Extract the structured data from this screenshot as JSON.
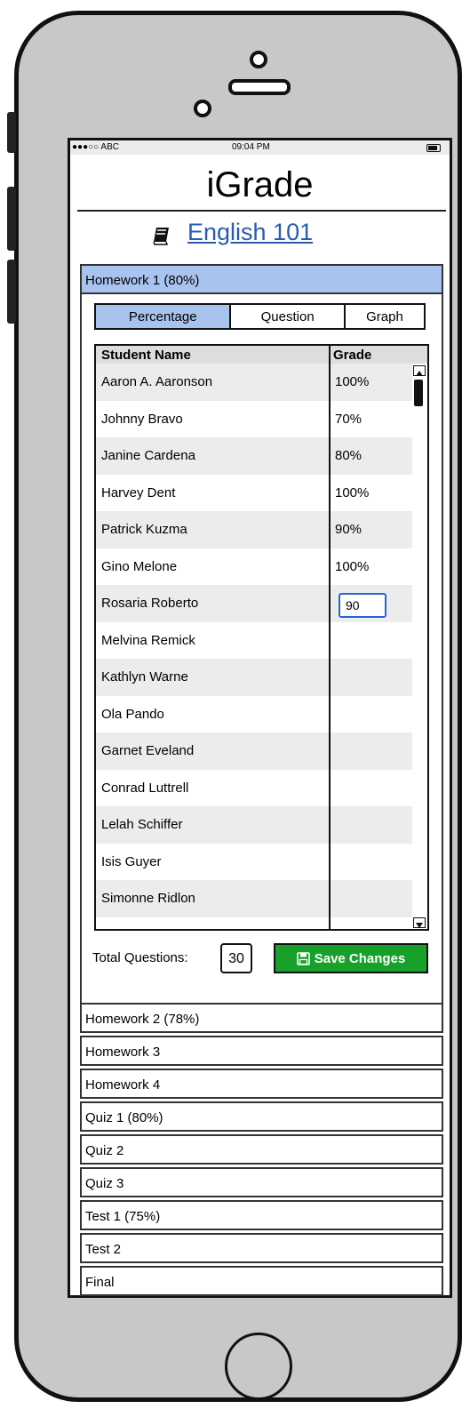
{
  "status_bar": {
    "carrier": "●●●○○ ABC",
    "time": "09:04 PM"
  },
  "app": {
    "title": "iGrade",
    "course": "English 101"
  },
  "open_section": {
    "label": "Homework 1 (80%)"
  },
  "tabs": [
    {
      "label": "Percentage",
      "active": true
    },
    {
      "label": "Question",
      "active": false
    },
    {
      "label": "Graph",
      "active": false
    }
  ],
  "grid": {
    "columns": [
      "Student Name",
      "Grade"
    ],
    "rows": [
      {
        "name": "Aaron A. Aaronson",
        "grade": "100%"
      },
      {
        "name": "Johnny Bravo",
        "grade": "70%"
      },
      {
        "name": "Janine Cardena",
        "grade": "80%"
      },
      {
        "name": "Harvey Dent",
        "grade": "100%"
      },
      {
        "name": "Patrick Kuzma",
        "grade": "90%"
      },
      {
        "name": "Gino Melone",
        "grade": "100%"
      },
      {
        "name": "Rosaria Roberto",
        "grade": ""
      },
      {
        "name": "Melvina Remick",
        "grade": ""
      },
      {
        "name": "Kathlyn Warne",
        "grade": ""
      },
      {
        "name": "Ola Pando",
        "grade": ""
      },
      {
        "name": "Garnet Eveland",
        "grade": ""
      },
      {
        "name": "Conrad Luttrell",
        "grade": ""
      },
      {
        "name": "Lelah Schiffer",
        "grade": ""
      },
      {
        "name": "Isis Guyer",
        "grade": ""
      },
      {
        "name": "Simonne Ridlon",
        "grade": ""
      }
    ],
    "editing_value": "90"
  },
  "footer": {
    "total_label": "Total Questions:",
    "total_value": "30",
    "save_label": "Save Changes"
  },
  "sections": [
    "Homework 2 (78%)",
    "Homework 3",
    "Homework 4",
    "Quiz 1 (80%)",
    "Quiz 2",
    "Quiz 3",
    "Test 1 (75%)",
    "Test 2",
    "Final"
  ],
  "colors": {
    "accent": "#a9c3ef",
    "link": "#2a5bb0",
    "save": "#17a12a",
    "input_border": "#2a63d6"
  }
}
